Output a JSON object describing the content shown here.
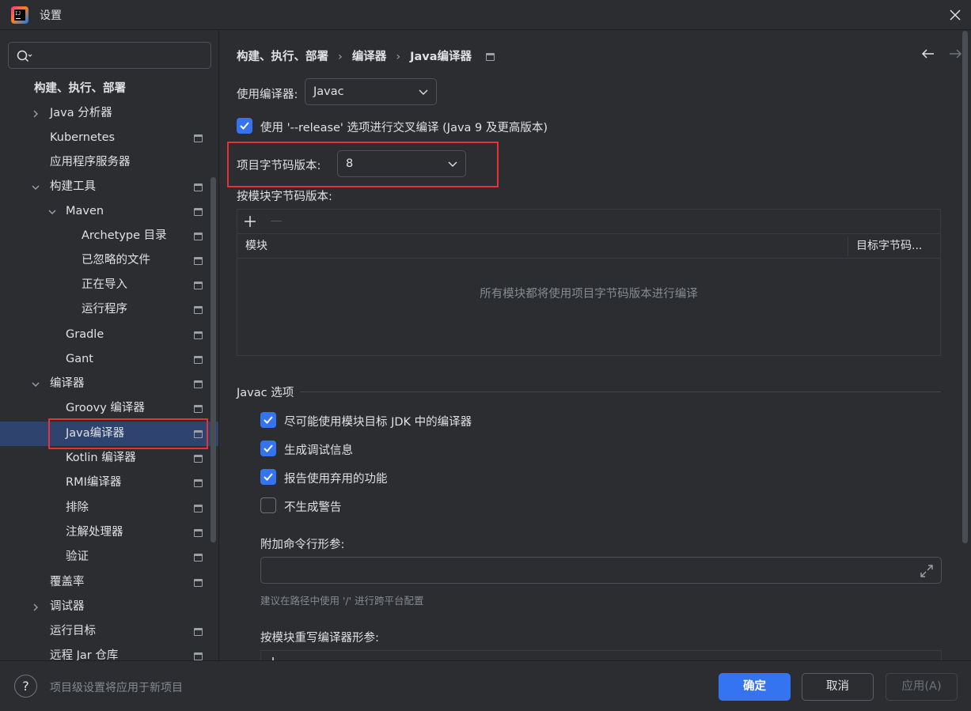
{
  "window": {
    "title": "设置"
  },
  "search": {
    "placeholder": "",
    "value": ""
  },
  "sidebar": {
    "items": [
      {
        "label": "构建、执行、部署"
      },
      {
        "label": "Java 分析器"
      },
      {
        "label": "Kubernetes"
      },
      {
        "label": "应用程序服务器"
      },
      {
        "label": "构建工具"
      },
      {
        "label": "Maven"
      },
      {
        "label": "Archetype 目录"
      },
      {
        "label": "已忽略的文件"
      },
      {
        "label": "正在导入"
      },
      {
        "label": "运行程序"
      },
      {
        "label": "Gradle"
      },
      {
        "label": "Gant"
      },
      {
        "label": "编译器"
      },
      {
        "label": "Groovy 编译器"
      },
      {
        "label": "Java编译器"
      },
      {
        "label": "Kotlin 编译器"
      },
      {
        "label": "RMI编译器"
      },
      {
        "label": "排除"
      },
      {
        "label": "注解处理器"
      },
      {
        "label": "验证"
      },
      {
        "label": "覆盖率"
      },
      {
        "label": "调试器"
      },
      {
        "label": "运行目标"
      },
      {
        "label": "远程 Jar 仓库"
      }
    ]
  },
  "breadcrumb": [
    "构建、执行、部署",
    "编译器",
    "Java编译器"
  ],
  "compiler": {
    "use_compiler_label": "使用编译器:",
    "compiler_value": "Javac",
    "release_option_label": "使用 '--release' 选项进行交叉编译 (Java 9 及更高版本)",
    "release_option_checked": true,
    "bytecode_label": "项目字节码版本:",
    "bytecode_value": "8",
    "per_module_label": "按模块字节码版本:"
  },
  "module_table": {
    "col_module": "模块",
    "col_target": "目标字节码...",
    "empty_text": "所有模块都将使用项目字节码版本进行编译"
  },
  "javac": {
    "section_title": "Javac 选项",
    "options": [
      {
        "label": "尽可能使用模块目标 JDK 中的编译器",
        "checked": true
      },
      {
        "label": "生成调试信息",
        "checked": true
      },
      {
        "label": "报告使用弃用的功能",
        "checked": true
      },
      {
        "label": "不生成警告",
        "checked": false
      }
    ],
    "args_label": "附加命令行形参:",
    "args_value": "",
    "args_hint": "建议在路径中使用 '/' 进行跨平台配置",
    "override_label": "按模块重写编译器形参:"
  },
  "footer": {
    "help": "?",
    "text": "项目级设置将应用于新项目",
    "ok": "确定",
    "cancel": "取消",
    "apply": "应用(A)"
  },
  "colors": {
    "background": "#2b2d30",
    "accent": "#3574f0",
    "selection": "#2e436e",
    "highlight": "#e5313b"
  }
}
